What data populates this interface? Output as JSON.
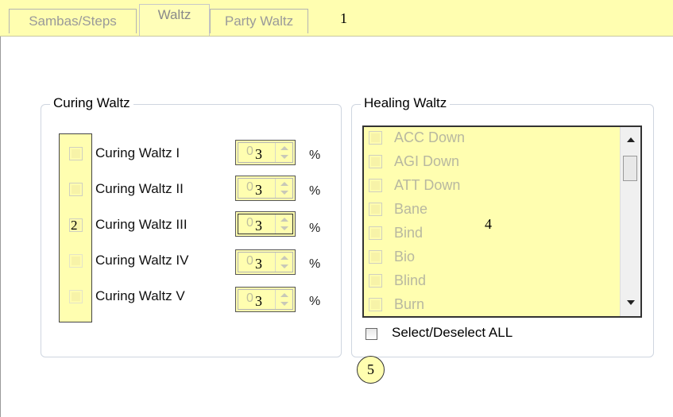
{
  "tabs": [
    {
      "label": "Sambas/Steps",
      "active": false
    },
    {
      "label": "Waltz",
      "active": true
    },
    {
      "label": "Party Waltz",
      "active": false
    }
  ],
  "annotations": {
    "one": "1",
    "two": "2",
    "four": "4",
    "five": "5"
  },
  "curing_group": {
    "title": "Curing Waltz",
    "rows": [
      {
        "label": "Curing Waltz I",
        "ghost": "0",
        "value": "3",
        "unit": "%",
        "checked": false,
        "enabled": true
      },
      {
        "label": "Curing Waltz II",
        "ghost": "0",
        "value": "3",
        "unit": "%",
        "checked": false,
        "enabled": true
      },
      {
        "label": "Curing Waltz III",
        "ghost": "0",
        "value": "3",
        "unit": "%",
        "checked": true,
        "enabled": true
      },
      {
        "label": "Curing Waltz IV",
        "ghost": "0",
        "value": "3",
        "unit": "%",
        "checked": false,
        "enabled": false
      },
      {
        "label": "Curing Waltz V",
        "ghost": "0",
        "value": "3",
        "unit": "%",
        "checked": false,
        "enabled": false
      }
    ]
  },
  "healing_group": {
    "title": "Healing Waltz",
    "items": [
      "ACC Down",
      "AGI Down",
      "ATT Down",
      "Bane",
      "Bind",
      "Bio",
      "Blind",
      "Burn"
    ],
    "select_all_label": "Select/Deselect ALL"
  },
  "colors": {
    "highlight": "#fffeb0",
    "groupBorder": "#cfd6e0"
  }
}
